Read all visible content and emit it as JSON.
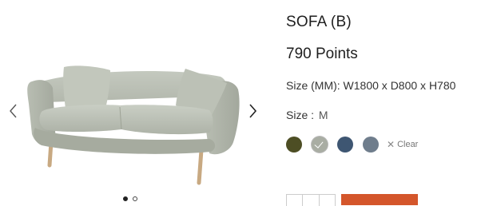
{
  "product": {
    "title": "SOFA (B)",
    "price": "790 Points",
    "dimensions": "Size (MM): W1800 x D800 x H780",
    "size_label": "Size",
    "size_separator": ":",
    "size_value": "M"
  },
  "gallery": {
    "prev_icon": "chevron-left-icon",
    "next_icon": "chevron-right-icon",
    "slide_count": 2,
    "active_slide": 1
  },
  "colors": [
    {
      "name": "olive",
      "hex": "#4d4e24",
      "selected": false
    },
    {
      "name": "sage-grey",
      "hex": "#a9ada3",
      "selected": true
    },
    {
      "name": "navy",
      "hex": "#3e5672",
      "selected": false
    },
    {
      "name": "slate-blue",
      "hex": "#6f7d8c",
      "selected": false
    }
  ],
  "clear_label": "Clear",
  "accent_color": "#d4562b"
}
